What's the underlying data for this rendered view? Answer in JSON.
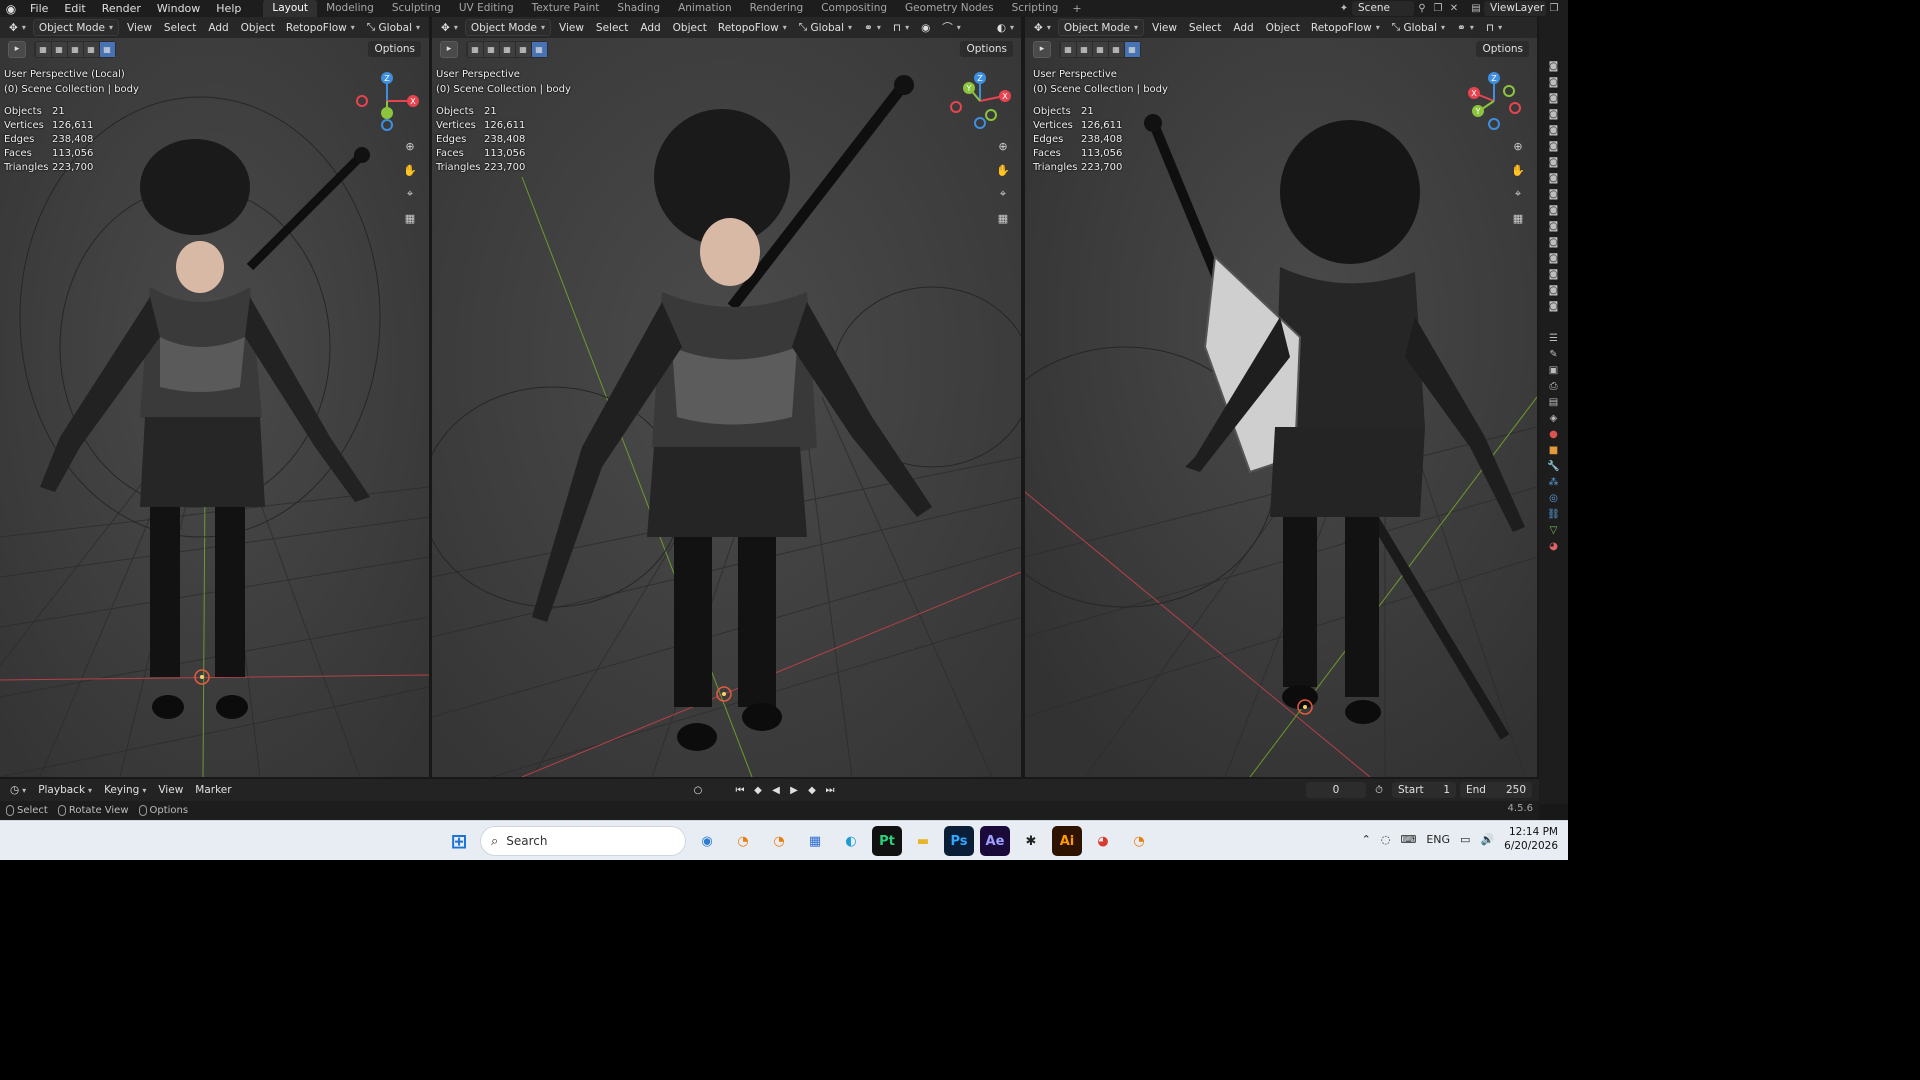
{
  "topbar": {
    "menus": [
      "File",
      "Edit",
      "Render",
      "Window",
      "Help"
    ],
    "workspaces": [
      "Layout",
      "Modeling",
      "Sculpting",
      "UV Editing",
      "Texture Paint",
      "Shading",
      "Animation",
      "Rendering",
      "Compositing",
      "Geometry Nodes",
      "Scripting"
    ],
    "active_workspace": "Layout",
    "add_tab": "+",
    "scene": "Scene",
    "view_layer": "ViewLayer"
  },
  "viewport_header": {
    "mode": "Object Mode",
    "menus": [
      "View",
      "Select",
      "Add",
      "Object"
    ],
    "addon": "RetopoFlow",
    "orientation": "Global",
    "options": "Options"
  },
  "viewports": [
    {
      "title": "User Perspective (Local)",
      "collection": "(0) Scene Collection | body",
      "stats": [
        {
          "k": "Objects",
          "v": "21"
        },
        {
          "k": "Vertices",
          "v": "126,611"
        },
        {
          "k": "Edges",
          "v": "238,408"
        },
        {
          "k": "Faces",
          "v": "113,056"
        },
        {
          "k": "Triangles",
          "v": "223,700"
        }
      ]
    },
    {
      "title": "User Perspective",
      "collection": "(0) Scene Collection | body",
      "stats": [
        {
          "k": "Objects",
          "v": "21"
        },
        {
          "k": "Vertices",
          "v": "126,611"
        },
        {
          "k": "Edges",
          "v": "238,408"
        },
        {
          "k": "Faces",
          "v": "113,056"
        },
        {
          "k": "Triangles",
          "v": "223,700"
        }
      ]
    },
    {
      "title": "User Perspective",
      "collection": "(0) Scene Collection | body",
      "stats": [
        {
          "k": "Objects",
          "v": "21"
        },
        {
          "k": "Vertices",
          "v": "126,611"
        },
        {
          "k": "Edges",
          "v": "238,408"
        },
        {
          "k": "Faces",
          "v": "113,056"
        },
        {
          "k": "Triangles",
          "v": "223,700"
        }
      ]
    }
  ],
  "gizmo_axes": {
    "x": "X",
    "y": "Y",
    "z": "Z"
  },
  "timeline": {
    "menus": [
      "Playback",
      "Keying",
      "View",
      "Marker"
    ],
    "current_frame": "0",
    "start_label": "Start",
    "start_value": "1",
    "end_label": "End",
    "end_value": "250"
  },
  "statusbar": {
    "items": [
      "Select",
      "Rotate View",
      "Options"
    ],
    "version": "4.5.6"
  },
  "taskbar": {
    "search_placeholder": "Search",
    "apps": [
      "Pt",
      "Ps",
      "Ae",
      "Ai"
    ],
    "language": "ENG",
    "time": "12:14 PM",
    "date": "6/20/2026"
  },
  "colors": {
    "accent": "#4772b3",
    "x_axis": "#e8444f",
    "y_axis": "#8cc43d",
    "z_axis": "#3f8fe0"
  }
}
